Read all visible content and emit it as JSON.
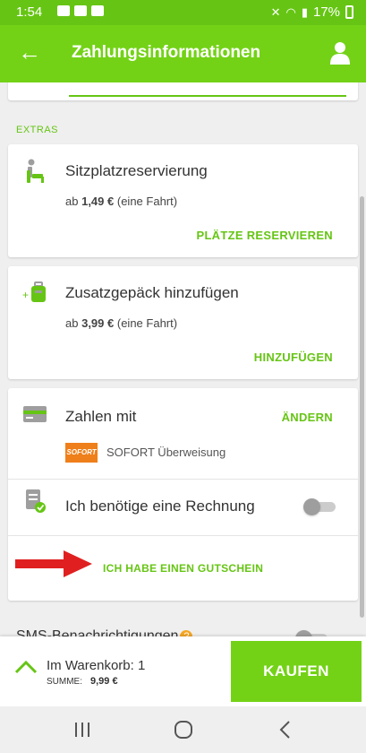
{
  "status_bar": {
    "time": "1:54",
    "battery": "17%"
  },
  "app_bar": {
    "title": "Zahlungsinformationen"
  },
  "extras": {
    "section_label": "EXTRAS",
    "seat": {
      "title": "Sitzplatzreservierung",
      "price_prefix": "ab",
      "price": "1,49 €",
      "price_suffix": "(eine Fahrt)",
      "action": "PLÄTZE RESERVIEREN"
    },
    "baggage": {
      "title": "Zusatzgepäck hinzufügen",
      "price_prefix": "ab",
      "price": "3,99 €",
      "price_suffix": "(eine Fahrt)",
      "action": "HINZUFÜGEN"
    }
  },
  "payment": {
    "title": "Zahlen mit",
    "change_action": "ÄNDERN",
    "method_logo": "SOFORT",
    "method_label": "SOFORT Überweisung",
    "invoice_label": "Ich benötige eine Rechnung",
    "invoice_enabled": false,
    "voucher_action": "ICH HABE EINEN GUTSCHEIN"
  },
  "sms": {
    "label": "SMS-Benachrichtigungen",
    "help": "?",
    "enabled": false
  },
  "cart": {
    "label": "Im Warenkorb: 1",
    "sum_label": "SUMME:",
    "sum_value": "9,99 €",
    "buy_label": "KAUFEN"
  },
  "colors": {
    "brand_green": "#73d216",
    "status_green": "#66c514",
    "arrow_red": "#e02020",
    "sofort_orange": "#ef7f1a"
  },
  "icons": {
    "back": "arrow-left-icon",
    "account": "user-icon",
    "seat": "seat-icon",
    "baggage": "luggage-add-icon",
    "card": "credit-card-icon",
    "invoice": "invoice-check-icon",
    "expand": "chevron-up-icon"
  }
}
